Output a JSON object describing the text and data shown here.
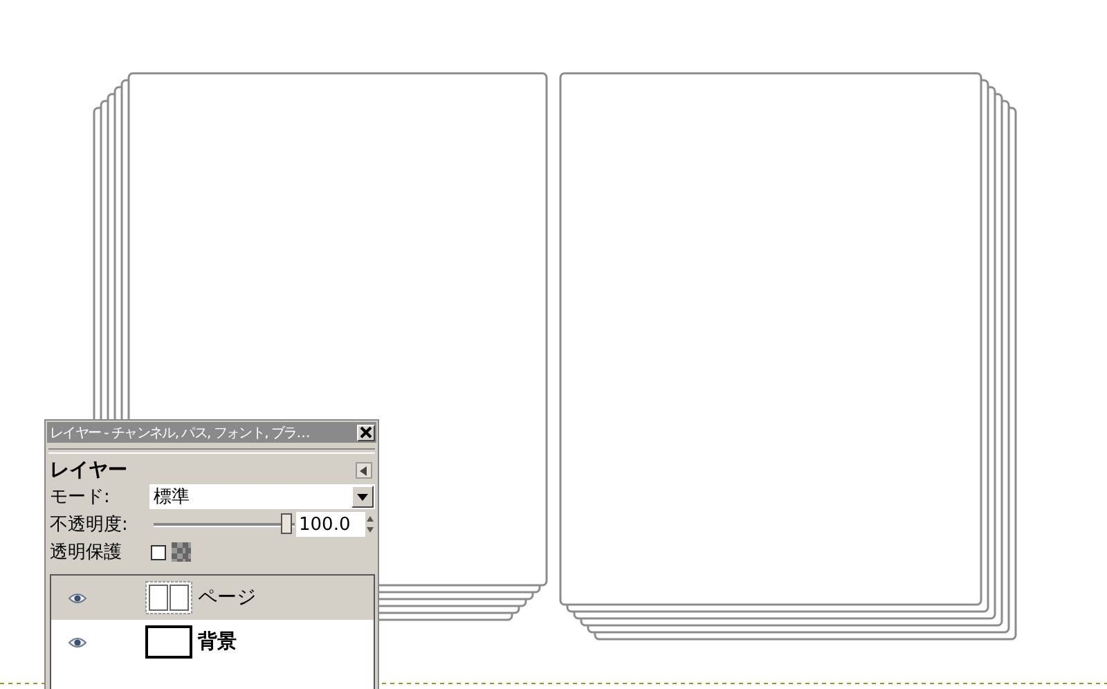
{
  "dialog": {
    "title": "レイヤー - チャンネル, パス, フォント, ブラ…",
    "panel_title": "レイヤー",
    "mode_label": "モード:",
    "mode_value": "標準",
    "opacity_label": "不透明度:",
    "opacity": {
      "level": 1,
      "reading": "100.0"
    },
    "lock_label": "透明保護",
    "lock_alpha": {
      "checked": false
    },
    "layers": [
      {
        "name": "ページ",
        "kind": "layer",
        "selected": true,
        "visible": true
      },
      {
        "name": "背景",
        "kind": "background",
        "selected": false,
        "visible": true
      }
    ]
  }
}
